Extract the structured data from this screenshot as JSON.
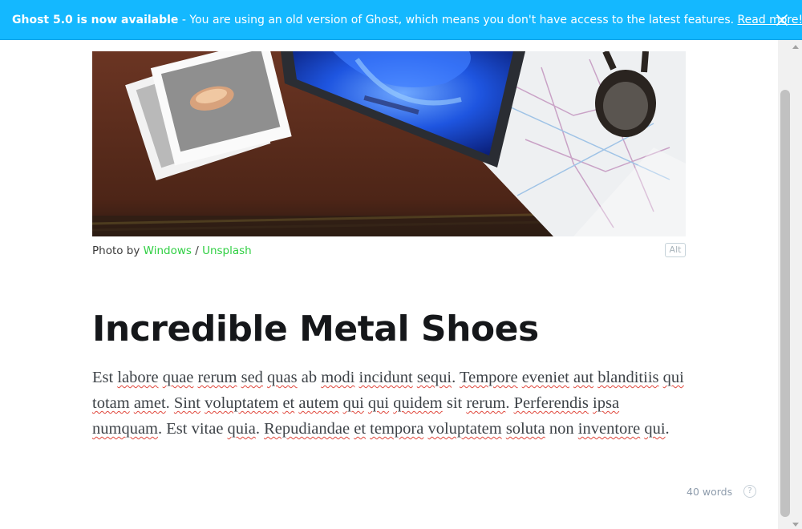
{
  "banner": {
    "title": "Ghost 5.0 is now available",
    "message": " - You are using an old version of Ghost, which means you don't have access to the latest features. ",
    "link": "Read more!"
  },
  "feature_image": {
    "description": "Windows tablet lying on a road map with photos and sunglasses"
  },
  "caption": {
    "prefix": "Photo by ",
    "author": "Windows",
    "separator": " / ",
    "source": "Unsplash",
    "alt_button": "Alt"
  },
  "post": {
    "title": "Incredible Metal Shoes",
    "words": [
      "Est",
      "labore",
      "quae",
      "rerum",
      "sed",
      "quas",
      "ab",
      "modi",
      "incidunt",
      "sequi.",
      "Tempore",
      "eveniet",
      "aut",
      "blanditiis",
      "qui",
      "totam",
      "amet.",
      "Sint",
      "voluptatem",
      "et",
      "autem",
      "qui",
      "qui",
      "quidem",
      "sit",
      "rerum.",
      "Perferendis",
      "ipsa",
      "numquam.",
      "Est",
      "vitae",
      "quia.",
      "Repudiandae",
      "et",
      "tempora",
      "voluptatem",
      "soluta",
      "non",
      "inventore",
      "qui."
    ],
    "misspelled": [
      false,
      true,
      true,
      true,
      true,
      true,
      false,
      true,
      true,
      true,
      true,
      true,
      true,
      true,
      true,
      true,
      true,
      true,
      true,
      true,
      true,
      true,
      true,
      true,
      false,
      true,
      true,
      true,
      true,
      false,
      false,
      true,
      true,
      true,
      true,
      true,
      true,
      false,
      true,
      true
    ]
  },
  "footer": {
    "word_count": "40 words",
    "help_icon": "?"
  },
  "colors": {
    "banner_bg": "#14b8ff",
    "accent_link": "#30cf43",
    "spellcheck": "#e0463b"
  }
}
